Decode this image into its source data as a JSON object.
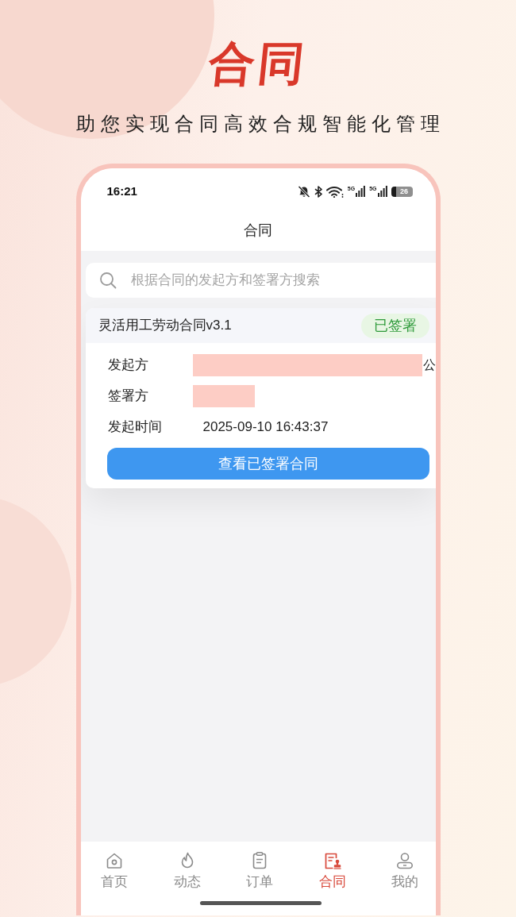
{
  "hero": {
    "title": "合同",
    "subtitle": "助您实现合同高效合规智能化管理"
  },
  "status_bar": {
    "time": "16:21",
    "signals": [
      "5G",
      "5G"
    ],
    "battery": "26"
  },
  "header": {
    "title": "合同"
  },
  "search": {
    "placeholder": "根据合同的发起方和签署方搜索"
  },
  "contracts": [
    {
      "title": "灵活用工劳动合同v3.1",
      "status": "已签署",
      "fields": [
        {
          "label": "发起方",
          "redacted": true,
          "value": "公"
        },
        {
          "label": "签署方",
          "redacted": true
        },
        {
          "label": "发起时间",
          "redacted": false,
          "value": "2025-09-10 16:43:37"
        }
      ],
      "action": "查看已签署合同"
    }
  ],
  "tab_bar": [
    {
      "label": "首页",
      "selected": false
    },
    {
      "label": "动态",
      "selected": false
    },
    {
      "label": "订单",
      "selected": false
    },
    {
      "label": "合同",
      "selected": true
    },
    {
      "label": "我的",
      "selected": false
    }
  ]
}
